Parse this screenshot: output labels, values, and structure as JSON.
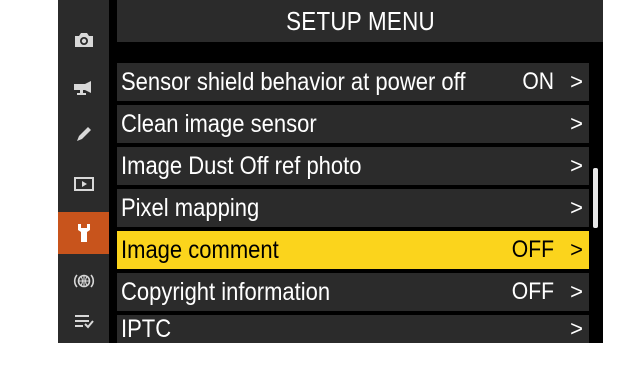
{
  "menu": {
    "title": "SETUP MENU"
  },
  "sidebar": {
    "items": [
      {
        "icon": "camera-icon",
        "label": "Photo shooting menu",
        "active": false
      },
      {
        "icon": "video-camera-icon",
        "label": "Video recording menu",
        "active": false
      },
      {
        "icon": "pencil-icon",
        "label": "Custom settings menu",
        "active": false
      },
      {
        "icon": "playback-icon",
        "label": "Playback menu",
        "active": false
      },
      {
        "icon": "wrench-icon",
        "label": "Setup menu",
        "active": true
      },
      {
        "icon": "network-icon",
        "label": "Network menu",
        "active": false
      },
      {
        "icon": "my-menu-icon",
        "label": "My Menu",
        "active": false
      }
    ],
    "active_color": "#c8541c"
  },
  "items": [
    {
      "label": "Sensor shield behavior at power off",
      "value": "ON",
      "chevron": ">"
    },
    {
      "label": "Clean image sensor",
      "value": "",
      "chevron": ">"
    },
    {
      "label": "Image Dust Off ref photo",
      "value": "",
      "chevron": ">"
    },
    {
      "label": "Pixel mapping",
      "value": "",
      "chevron": ">"
    },
    {
      "label": "Image comment",
      "value": "OFF",
      "chevron": ">"
    },
    {
      "label": "Copyright information",
      "value": "OFF",
      "chevron": ">"
    },
    {
      "label": "IPTC",
      "value": "",
      "chevron": ">"
    }
  ],
  "selected_index": 4,
  "colors": {
    "highlight": "#fbd41c",
    "row_bg": "#2b2b2b",
    "background": "#000000"
  }
}
